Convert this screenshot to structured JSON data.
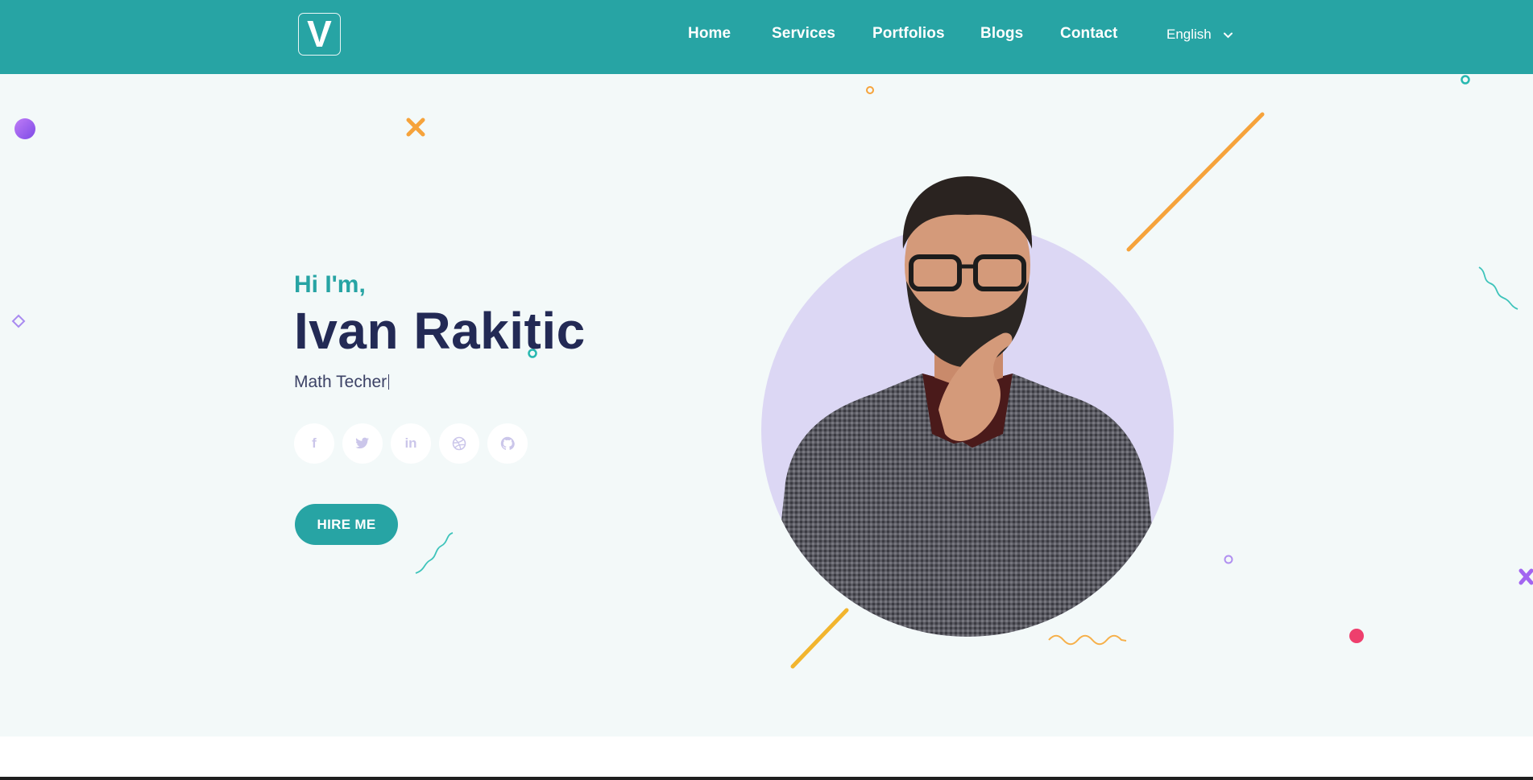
{
  "header": {
    "logo_letter": "V",
    "nav": [
      "Home",
      "Services",
      "Portfolios",
      "Blogs",
      "Contact"
    ],
    "language": "English"
  },
  "hero": {
    "greeting": "Hi I'm,",
    "name": "Ivan Rakitic",
    "role": "Math Techer",
    "hire_label": "HIRE ME",
    "socials": [
      {
        "icon": "facebook-icon",
        "glyph": "f"
      },
      {
        "icon": "twitter-icon",
        "glyph": "t"
      },
      {
        "icon": "linkedin-icon",
        "glyph": "in"
      },
      {
        "icon": "dribbble-icon",
        "glyph": "◎"
      },
      {
        "icon": "github-icon",
        "glyph": "◉"
      }
    ]
  },
  "colors": {
    "primary": "#27a4a4",
    "dark": "#232a55",
    "lavender": "#dcd7f4",
    "orange": "#f6a33b",
    "purple": "#a265f0",
    "pink": "#ee3f6d"
  }
}
